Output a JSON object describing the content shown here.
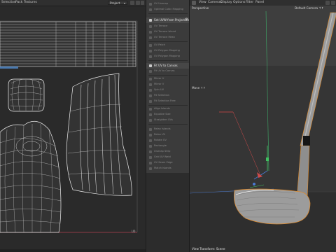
{
  "uv_editor": {
    "menu": [
      "Selection",
      "Pack",
      "Textures"
    ],
    "dropdown_value": "Project",
    "axis_label": "U0"
  },
  "tool_panel": {
    "items": [
      {
        "label": "UV Unwrap"
      },
      {
        "label": "Optimal Cubic Mapping"
      },
      {
        "label": "Set UVW from Projection",
        "highlight": true
      },
      {
        "label": "UV Terrace"
      },
      {
        "label": "UV Terrace Island"
      },
      {
        "label": "UV Terrace Mesh"
      },
      {
        "label": "UV Patch"
      },
      {
        "label": "UV Polygon Mapping"
      },
      {
        "label": "UV Polygon Mapping"
      },
      {
        "label": "Fit UV to Canvas",
        "highlight": true
      },
      {
        "label": "Fit UV to Canvas"
      },
      {
        "label": "Mirror U"
      },
      {
        "label": "Mirror V"
      },
      {
        "label": "Spin UV"
      },
      {
        "label": "Fit Selection"
      },
      {
        "label": "Fit Selection Free"
      },
      {
        "label": "Align Islands"
      },
      {
        "label": "Equalize Size"
      },
      {
        "label": "Straighten UVs"
      },
      {
        "label": "Relax Islands"
      },
      {
        "label": "Relax UV"
      },
      {
        "label": "Rotate UV"
      },
      {
        "label": "Rectangle"
      },
      {
        "label": "Unwrap Strip"
      },
      {
        "label": "Grid UV Weld"
      },
      {
        "label": "UV Seam Edge"
      },
      {
        "label": "Match Islands"
      },
      {
        "label": "Stitch UV"
      },
      {
        "label": "Weld UV"
      },
      {
        "label": "Scale UV"
      }
    ]
  },
  "viewport": {
    "menu": [
      "View",
      "Cameras",
      "Display",
      "Options",
      "Filter",
      "Panel"
    ],
    "view_name": "Perspective",
    "camera_name": "Default Camera",
    "camera_suffix": "↑↑",
    "move_label": "Move ↑↑",
    "status": "View Transform: Scene"
  },
  "colors": {
    "uv_line": "#e6e6e6",
    "axis_x": "#d04a4a",
    "axis_y": "#40c060",
    "axis_z": "#4a7ad0",
    "selection_outline": "#e08a2a"
  }
}
